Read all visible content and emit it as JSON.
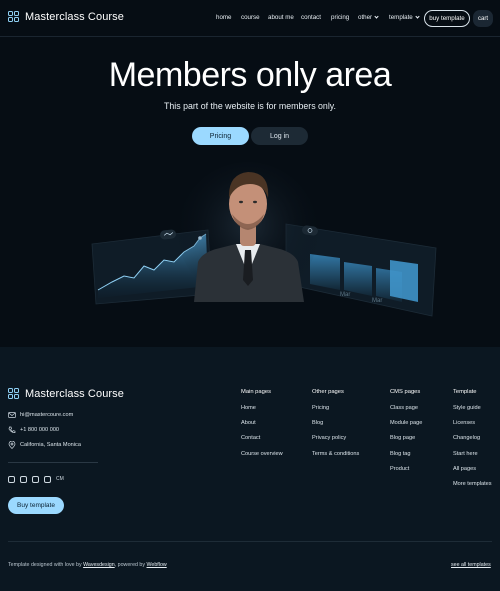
{
  "nav": {
    "brand": "Masterclass Course",
    "links": [
      "home",
      "course",
      "about me",
      "contact",
      "pricing",
      "other",
      "template"
    ],
    "buy_label": "buy template",
    "cart_label": "cart"
  },
  "hero": {
    "title": "Members only area",
    "subtitle": "This part of the website is for members only.",
    "pricing_label": "Pricing",
    "login_label": "Log in",
    "card_labels": [
      "Mar",
      "Mar"
    ]
  },
  "footer": {
    "brand": "Masterclass Course",
    "email": "hi@mastercoure.com",
    "phone": "+1 800 000 000",
    "location": "California, Santa Monica",
    "social_icons": [
      "instagram-icon",
      "youtube-icon",
      "facebook-icon",
      "snapchat-icon"
    ],
    "social_text": "CM",
    "buy_label": "Buy template",
    "columns": [
      {
        "title": "Main pages",
        "items": [
          "Home",
          "About",
          "Contact",
          "Course overview"
        ]
      },
      {
        "title": "Other pages",
        "items": [
          "Pricing",
          "Blog",
          "Privacy policy",
          "Terms & conditions"
        ]
      },
      {
        "title": "CMS pages",
        "items": [
          "Class page",
          "Module page",
          "Blog page",
          "Blog tag",
          "Product"
        ]
      },
      {
        "title": "Template",
        "items": [
          "Style guide",
          "Licenses",
          "Changelog",
          "Start here",
          "All pages",
          "More templates"
        ]
      }
    ],
    "credits_prefix": "Template designed with love by ",
    "credits_designer": "Wavesdesign",
    "credits_mid": ", powered by ",
    "credits_platform": "Webflow",
    "see_all": "see all templates"
  },
  "colors": {
    "background": "#060d14",
    "footer_bg": "#0b1721",
    "accent": "#9bd9ff"
  }
}
